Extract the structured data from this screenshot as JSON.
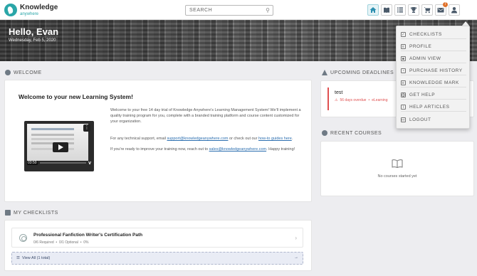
{
  "brand": {
    "name": "Knowledge",
    "sub": "anywhere"
  },
  "search": {
    "placeholder": "SEARCH"
  },
  "nav": {
    "icons": [
      "home-icon",
      "library-icon",
      "list-icon",
      "trophy-icon",
      "cart-icon",
      "mail-icon",
      "user-icon"
    ],
    "mail_badge": "7"
  },
  "hero": {
    "greeting": "Hello, Evan",
    "date": "Wednesday, Feb 5, 2020"
  },
  "welcome": {
    "header": "WELCOME",
    "title": "Welcome to your new Learning System!",
    "p1": "Welcome to your free 14 day trial of Knowledge Anywhere's Learning Management System! We'll implement a quality training program for you, complete with a branded training platform and course content customized for your organization.",
    "p2_prefix": "For any technical support, email ",
    "p2_email": "support@knowledgeanywhere.com",
    "p2_mid": " or check out our ",
    "p2_link": "how-to guides here",
    "p2_suffix": ".",
    "p3_prefix": "If you're ready to improve your training now, reach out to ",
    "p3_email": "sales@knowledgeanywhere.com",
    "p3_suffix": ". Happy training!",
    "video": {
      "time": "03:50",
      "brand": "v"
    }
  },
  "deadlines": {
    "header": "UPCOMING DEADLINES",
    "items": [
      {
        "title": "test",
        "status": "56 days overdue",
        "type": "eLearning"
      }
    ]
  },
  "recent": {
    "header": "RECENT COURSES",
    "empty": "No courses started yet"
  },
  "checklists": {
    "header": "MY CHECKLISTS",
    "item": {
      "title": "Professional Fanfiction Writer's Certification Path",
      "required": "0/6 Required",
      "optional": "0/1 Optional",
      "percent": "0%"
    },
    "view_all": "View All (1 total)"
  },
  "menu": {
    "items": [
      "CHECKLISTS",
      "PROFILE",
      "ADMIN VIEW",
      "PURCHASE HISTORY",
      "KNOWLEDGE MARK",
      "GET HELP",
      "HELP ARTICLES",
      "LOGOUT"
    ]
  },
  "colors": {
    "accent": "#2aa6a8",
    "overdue": "#e05050",
    "badge": "#e0722c"
  }
}
